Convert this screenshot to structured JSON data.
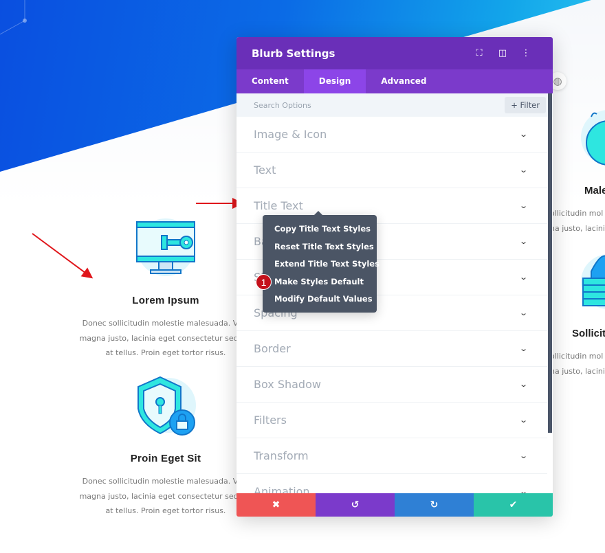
{
  "colors": {
    "header": "#6a2fb8",
    "tabs": "#7b3acb",
    "active_tab": "#8c45e8",
    "cancel": "#ef5555",
    "undo": "#7b3acb",
    "redo": "#2f80d5",
    "save": "#29c4a9",
    "badge": "#c4111b",
    "arrow": "#e0161b"
  },
  "panel": {
    "title": "Blurb Settings",
    "header_icons": [
      "fullscreen-icon",
      "split-view-icon",
      "more-icon"
    ],
    "tabs": [
      {
        "label": "Content"
      },
      {
        "label": "Design",
        "active": true
      },
      {
        "label": "Advanced"
      }
    ],
    "search_placeholder": "Search Options",
    "filter_label": "+ Filter",
    "sections": [
      "Image & Icon",
      "Text",
      "Title Text",
      "Background",
      "Sizing",
      "Spacing",
      "Border",
      "Box Shadow",
      "Filters",
      "Transform",
      "Animation"
    ],
    "footer": {
      "cancel": "✖",
      "undo": "↺",
      "redo": "↻",
      "save": "✔"
    }
  },
  "context_menu": {
    "items": [
      "Copy Title Text Styles",
      "Reset Title Text Styles",
      "Extend Title Text Styles",
      "Make Styles Default",
      "Modify Default Values"
    ],
    "badge": "1"
  },
  "blurbs": [
    {
      "title": "Lorem Ipsum",
      "lines": [
        "Donec sollicitudin molestie malesuada. Viva",
        "magna justo, lacinia eget consectetur sed, co",
        "at tellus. Proin eget tortor risus."
      ]
    },
    {
      "title": "Proin Eget Sit",
      "lines": [
        "Donec sollicitudin molestie malesuada. Viva",
        "magna justo, lacinia eget consectetur sed, co",
        "at tellus. Proin eget tortor risus."
      ]
    }
  ],
  "right_blurbs": [
    {
      "title": "Male",
      "lines": [
        "ollicitudin mol",
        "na justo, lacinia"
      ]
    },
    {
      "title": "Sollicit",
      "lines": [
        "ollicitudin mol",
        "na justo, lacinia"
      ]
    }
  ]
}
